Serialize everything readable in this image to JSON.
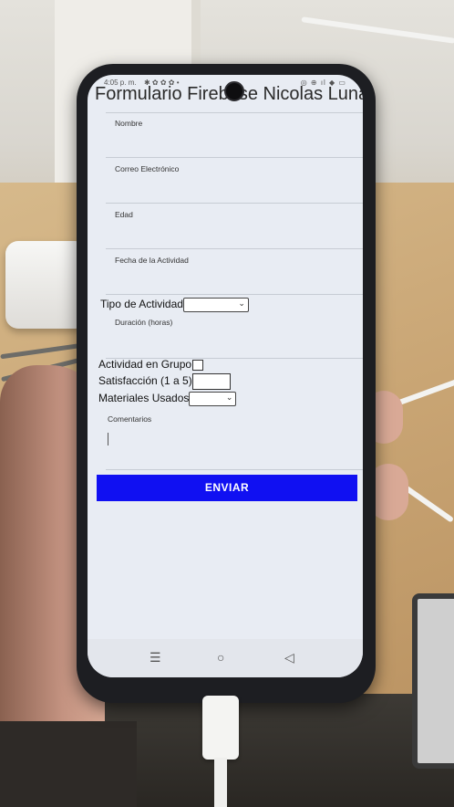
{
  "status": {
    "time": "4:05 p. m.",
    "left_icons": "✱ ✿ ✿ ✿ •",
    "right_icons": "◎ ⊕ ıl ◆ ▭"
  },
  "form": {
    "title": "Formulario Firebase Nicolas Luna",
    "fields": {
      "nombre": "Nombre",
      "correo": "Correo Electrónico",
      "edad": "Edad",
      "fecha": "Fecha de la Actividad",
      "tipo": "Tipo de Actividad",
      "duracion": "Duración (horas)",
      "grupo": "Actividad en Grupo",
      "satisfaccion": "Satisfacción (1 a 5)",
      "materiales": "Materiales Usados",
      "comentarios": "Comentarios"
    },
    "submit_label": "ENVIAR"
  },
  "nav": {
    "recents_icon": "menu-lines-icon",
    "home_icon": "circle-icon",
    "back_icon": "triangle-back-icon",
    "recents_glyph": "☰",
    "home_glyph": "○",
    "back_glyph": "◁"
  },
  "colors": {
    "submit_bg": "#1010f2",
    "screen_bg": "#e8ecf3"
  }
}
